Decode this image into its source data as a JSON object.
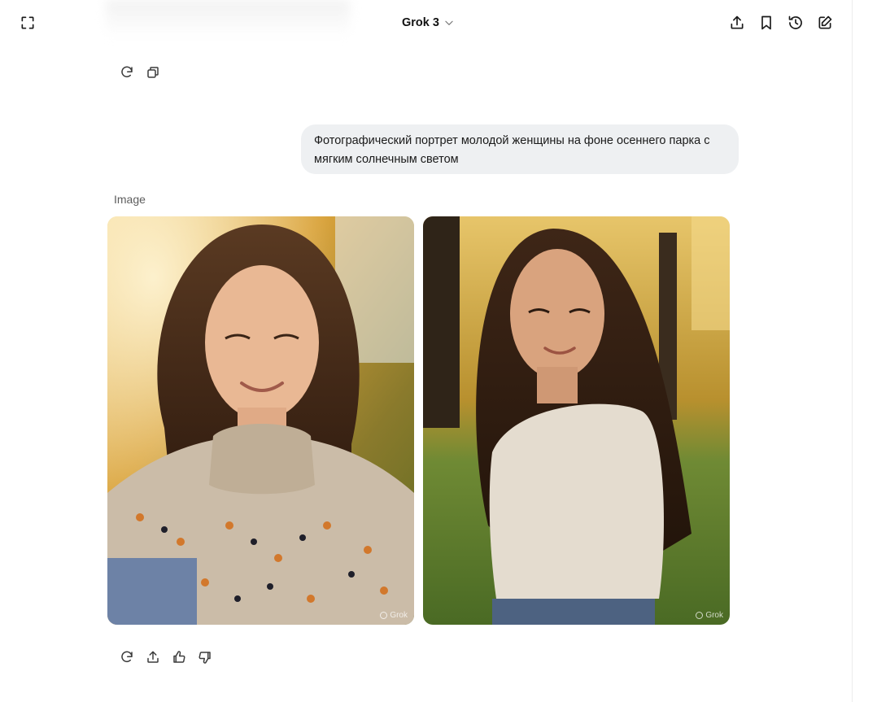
{
  "header": {
    "model_name": "Grok 3",
    "icons": {
      "expand": "fullscreen-icon",
      "model_dropdown": "chevron-down-icon",
      "share": "share-icon",
      "bookmark": "bookmark-icon",
      "history": "history-icon",
      "new_chat": "edit-icon"
    }
  },
  "previous_message_actions": {
    "icons": [
      "regenerate-icon",
      "copy-icon"
    ]
  },
  "user_message": {
    "text": "Фотографический портрет молодой женщины на фоне осеннего парка с мягким солнечным светом"
  },
  "assistant_response": {
    "section_label": "Image",
    "images": [
      {
        "description": "portrait-woman-patterned-sweater",
        "watermark": "Grok"
      },
      {
        "description": "portrait-woman-cream-sweater",
        "watermark": "Grok"
      }
    ],
    "actions": [
      "regenerate-icon",
      "share-icon",
      "thumbs-up-icon",
      "thumbs-down-icon"
    ]
  },
  "colors": {
    "bubble_bg": "#eef0f2",
    "text": "#1a1a1a",
    "muted": "#5d5d5d"
  }
}
